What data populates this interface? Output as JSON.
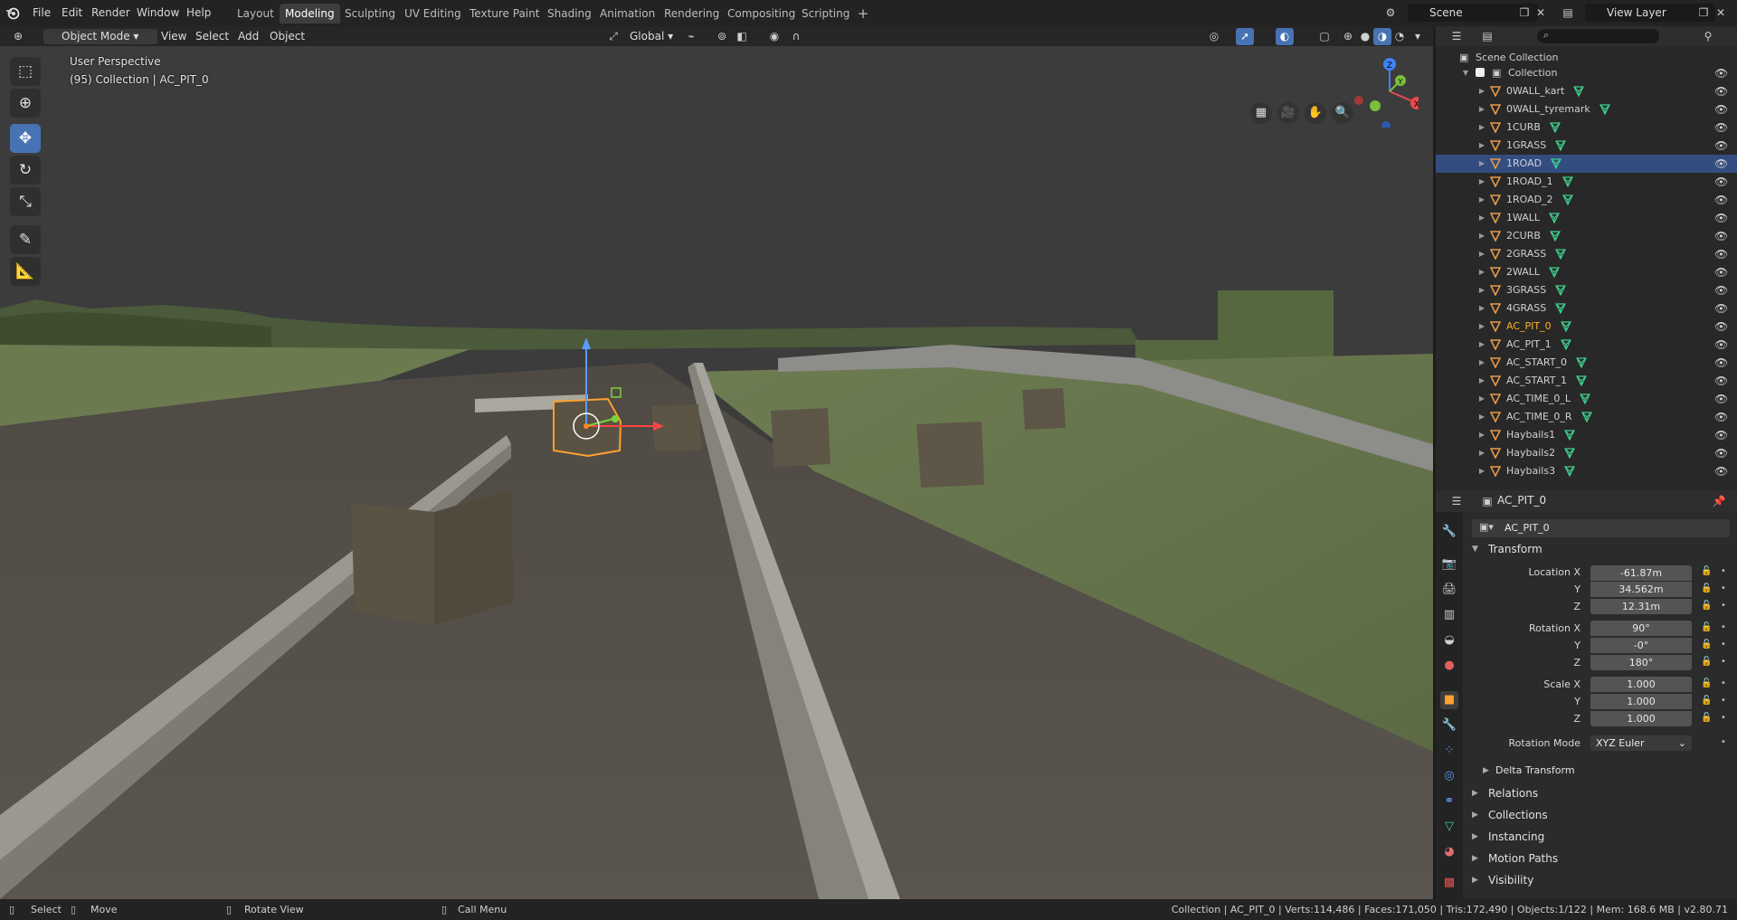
{
  "menu": [
    "File",
    "Edit",
    "Render",
    "Window",
    "Help"
  ],
  "workspaces": [
    "Layout",
    "Modeling",
    "Sculpting",
    "UV Editing",
    "Texture Paint",
    "Shading",
    "Animation",
    "Rendering",
    "Compositing",
    "Scripting"
  ],
  "active_workspace": "Modeling",
  "scene_name": "Scene",
  "view_layer": "View Layer",
  "viewport_header": {
    "mode": "Object Mode",
    "menus": [
      "View",
      "Select",
      "Add",
      "Object"
    ],
    "orientation": "Global"
  },
  "viewport": {
    "view_name": "User Perspective",
    "context_line": "(95) Collection | AC_PIT_0",
    "gizmo_axes": {
      "z": "Z",
      "y": "Y",
      "x": "X"
    }
  },
  "outliner": {
    "search_placeholder": "",
    "scene_collection": "Scene Collection",
    "collection": "Collection",
    "items": [
      {
        "name": "0WALL_kart"
      },
      {
        "name": "0WALL_tyremark"
      },
      {
        "name": "1CURB"
      },
      {
        "name": "1GRASS"
      },
      {
        "name": "1ROAD",
        "selected": true
      },
      {
        "name": "1ROAD_1"
      },
      {
        "name": "1ROAD_2"
      },
      {
        "name": "1WALL"
      },
      {
        "name": "2CURB"
      },
      {
        "name": "2GRASS"
      },
      {
        "name": "2WALL"
      },
      {
        "name": "3GRASS"
      },
      {
        "name": "4GRASS"
      },
      {
        "name": "AC_PIT_0",
        "active": true
      },
      {
        "name": "AC_PIT_1"
      },
      {
        "name": "AC_START_0"
      },
      {
        "name": "AC_START_1"
      },
      {
        "name": "AC_TIME_0_L"
      },
      {
        "name": "AC_TIME_0_R"
      },
      {
        "name": "Haybails1"
      },
      {
        "name": "Haybails2"
      },
      {
        "name": "Haybails3"
      }
    ]
  },
  "properties": {
    "header_object": "AC_PIT_0",
    "object_name": "AC_PIT_0",
    "transform_label": "Transform",
    "location": {
      "label": "Location X",
      "x": "-61.87m",
      "y": "34.562m",
      "z": "12.31m"
    },
    "rotation": {
      "label": "Rotation X",
      "x": "90°",
      "y": "-0°",
      "z": "180°"
    },
    "scale": {
      "label": "Scale X",
      "x": "1.000",
      "y": "1.000",
      "z": "1.000"
    },
    "axis_y": "Y",
    "axis_z": "Z",
    "rotation_mode_label": "Rotation Mode",
    "rotation_mode": "XYZ Euler",
    "delta_transform": "Delta Transform",
    "panels": [
      "Relations",
      "Collections",
      "Instancing",
      "Motion Paths",
      "Visibility"
    ]
  },
  "statusbar": {
    "select": "Select",
    "move": "Move",
    "rotate": "Rotate View",
    "call_menu": "Call Menu",
    "stats": "Collection | AC_PIT_0 | Verts:114,486 | Faces:171,050 | Tris:172,490 | Objects:1/122 | Mem: 168.6 MB | v2.80.71"
  },
  "colors": {
    "accent": "#4772b3",
    "active_object": "#ffaf29",
    "selected_row": "#334d80"
  }
}
